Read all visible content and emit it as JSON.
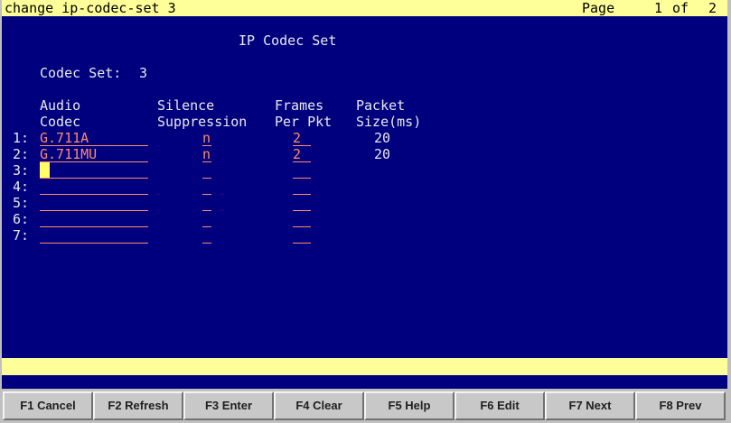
{
  "title_bar": {
    "command": "change ip-codec-set 3",
    "page_label": "Page",
    "page_current": "1",
    "page_of": "of",
    "page_total": "2"
  },
  "form": {
    "heading": "IP Codec Set",
    "codec_set_label": "Codec Set:",
    "codec_set_value": "3",
    "columns": {
      "codec_top": "Audio",
      "codec_bottom": "Codec",
      "silence_top": "Silence",
      "silence_bottom": "Suppression",
      "frames_top": "Frames",
      "frames_bottom": "Per Pkt",
      "packet_top": "Packet",
      "packet_bottom": "Size(ms)"
    },
    "rows": [
      {
        "num": "1:",
        "codec": "G.711A",
        "silence": "n",
        "frames": "2",
        "packet": "20"
      },
      {
        "num": "2:",
        "codec": "G.711MU",
        "silence": "n",
        "frames": "2",
        "packet": "20"
      },
      {
        "num": "3:",
        "codec": "",
        "silence": "",
        "frames": "",
        "packet": ""
      },
      {
        "num": "4:",
        "codec": "",
        "silence": "",
        "frames": "",
        "packet": ""
      },
      {
        "num": "5:",
        "codec": "",
        "silence": "",
        "frames": "",
        "packet": ""
      },
      {
        "num": "6:",
        "codec": "",
        "silence": "",
        "frames": "",
        "packet": ""
      },
      {
        "num": "7:",
        "codec": "",
        "silence": "",
        "frames": "",
        "packet": ""
      }
    ]
  },
  "message_line": "",
  "function_keys": [
    {
      "label": "F1 Cancel"
    },
    {
      "label": "F2 Refresh"
    },
    {
      "label": "F3 Enter"
    },
    {
      "label": "F4 Clear"
    },
    {
      "label": "F5 Help"
    },
    {
      "label": "F6 Edit"
    },
    {
      "label": "F7 Next"
    },
    {
      "label": "F8 Prev"
    }
  ],
  "colors": {
    "terminal_background": "#00007f",
    "status_bar": "#ffff99",
    "field_text": "#ff8c6a",
    "static_text": "#e8e8e8",
    "cursor": "#ffff66"
  }
}
